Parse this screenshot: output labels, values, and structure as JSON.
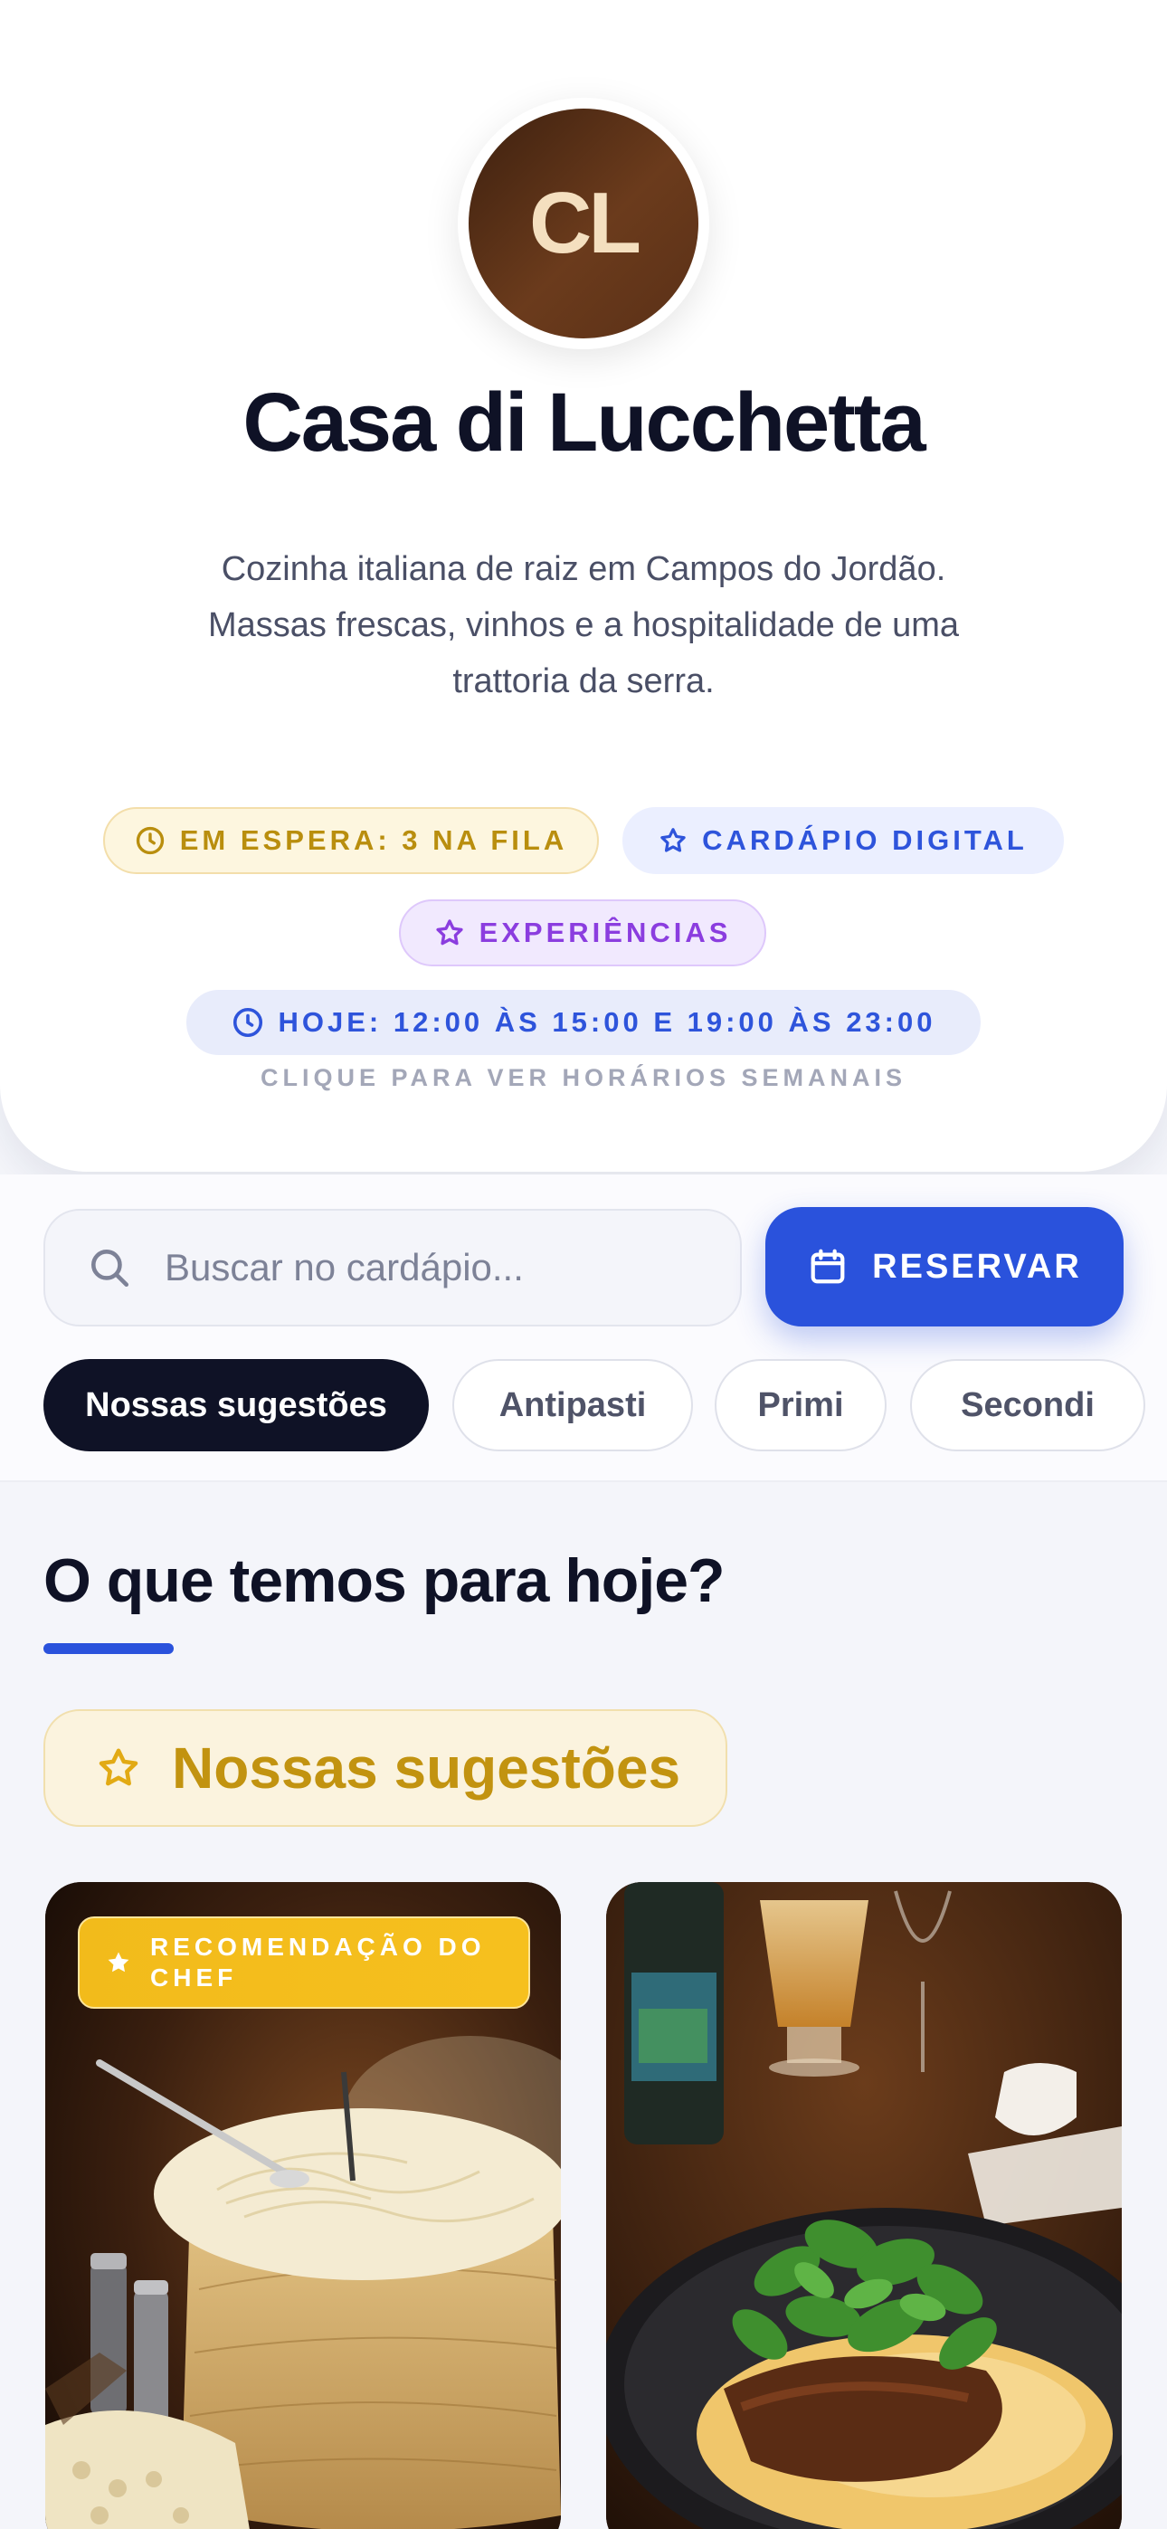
{
  "restaurant": {
    "initials": "CL",
    "name": "Casa di Lucchetta",
    "description": "Cozinha italiana de raiz em Campos do Jordão. Massas frescas, vinhos e a hospitalidade de uma trattoria da serra."
  },
  "badges": {
    "waitlist": "EM ESPERA: 3 NA FILA",
    "digital_menu": "CARDÁPIO DIGITAL",
    "experiences": "EXPERIÊNCIAS",
    "hours": "HOJE: 12:00 ÀS 15:00 E 19:00 ÀS 23:00",
    "hours_hint": "CLIQUE PARA VER HORÁRIOS SEMANAIS"
  },
  "search": {
    "placeholder": "Buscar no cardápio..."
  },
  "reserve_label": "RESERVAR",
  "categories": [
    "Nossas sugestões",
    "Antipasti",
    "Primi",
    "Secondi"
  ],
  "active_category": "Nossas sugestões",
  "section": {
    "title": "O que temos para hoje?",
    "category_header": "Nossas sugestões"
  },
  "cards": [
    {
      "tag": "RECOMENDAÇÃO DO CHEF",
      "image": "pasta-in-cheese-wheel"
    },
    {
      "image": "braised-meat-with-polenta-and-greens"
    }
  ],
  "colors": {
    "primary": "#2a52dc",
    "dark": "#0f1226",
    "gold": "#c29310",
    "purple": "#8b3ddf",
    "avatar": "#5a3017"
  }
}
